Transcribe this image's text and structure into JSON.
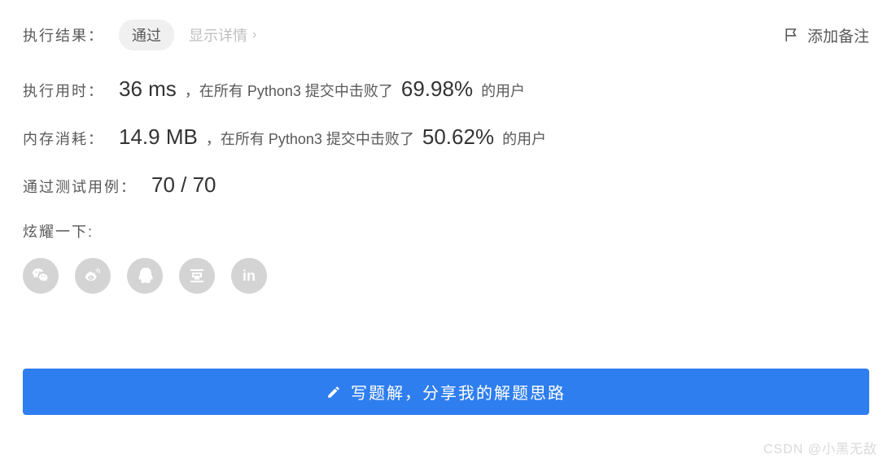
{
  "header": {
    "result_label": "执行结果：",
    "status": "通过",
    "detail_link": "显示详情",
    "add_note": "添加备注"
  },
  "runtime": {
    "label": "执行用时：",
    "value": "36 ms",
    "text_prefix": "，在所有 Python3 提交中击败了",
    "percent": "69.98%",
    "text_suffix": "的用户"
  },
  "memory": {
    "label": "内存消耗：",
    "value": "14.9 MB",
    "text_prefix": "，在所有 Python3 提交中击败了",
    "percent": "50.62%",
    "text_suffix": "的用户"
  },
  "testcases": {
    "label": "通过测试用例：",
    "value": "70 / 70"
  },
  "show_off": {
    "label": "炫耀一下:"
  },
  "share": {
    "wechat": "wechat-icon",
    "weibo": "weibo-icon",
    "qq": "qq-icon",
    "douban": "douban-icon",
    "linkedin": "linkedin-icon"
  },
  "write_solution_button": "写题解，分享我的解题思路",
  "watermark": "CSDN @小黑无敌"
}
